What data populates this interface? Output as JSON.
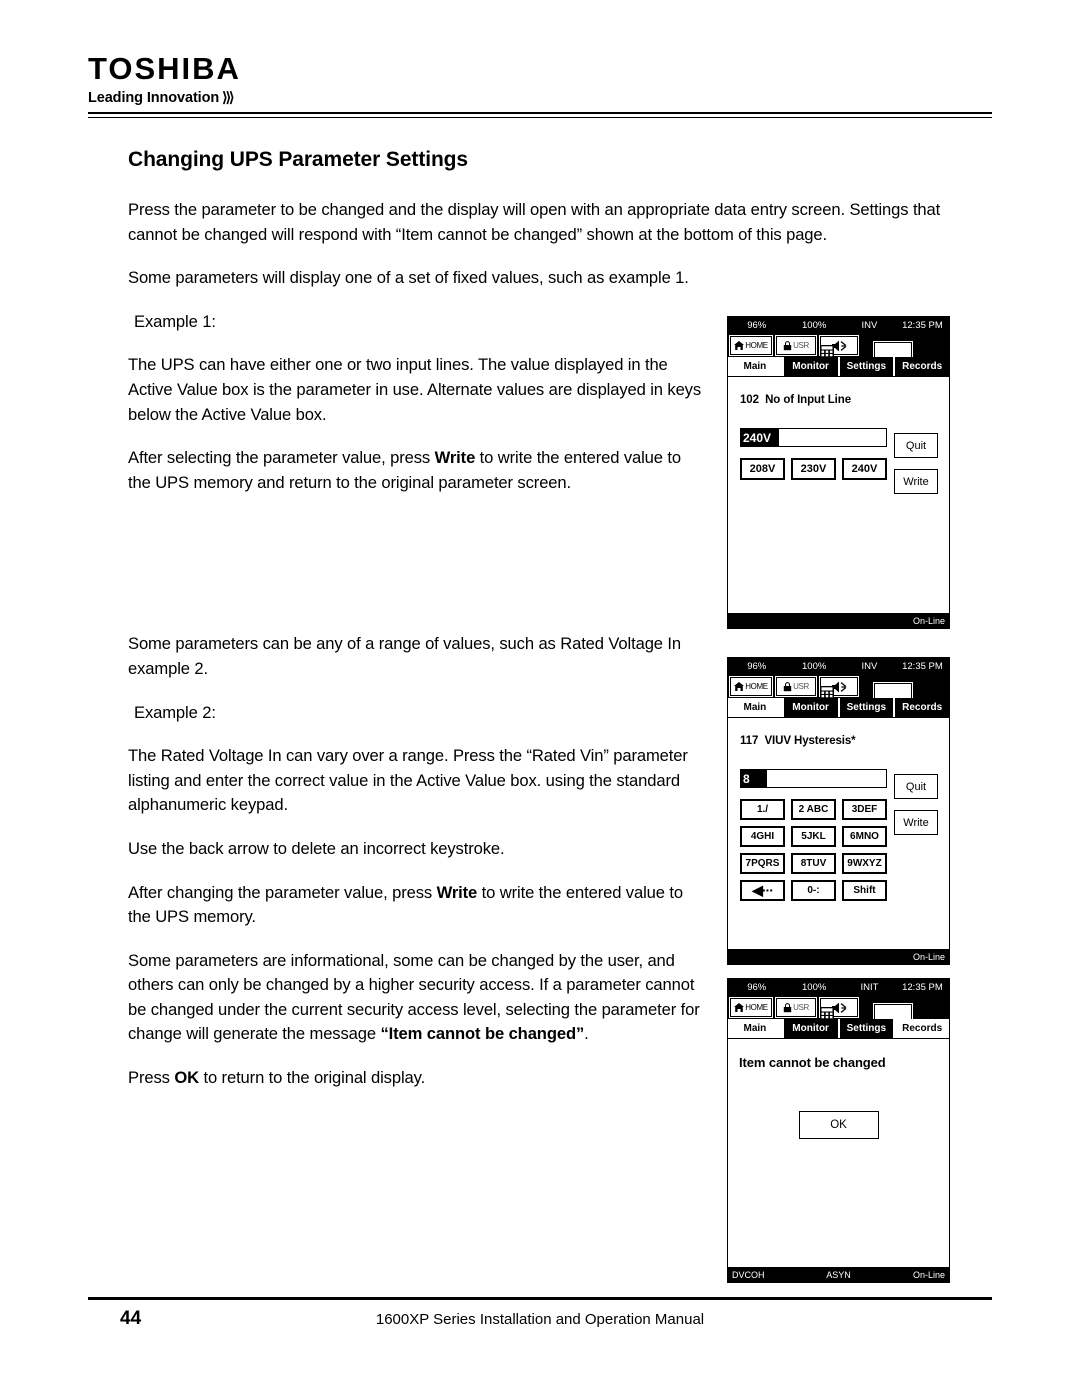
{
  "brand": {
    "name": "TOSHIBA",
    "tagline": "Leading Innovation",
    "chevrons": "≫>"
  },
  "page": {
    "title": "Changing UPS Parameter Settings",
    "paragraphs": {
      "p1": "Press the parameter to be changed and the display will open with an appropriate data entry screen. Settings that cannot be changed will respond with “Item cannot be changed” shown at the bottom of this page.",
      "p2": "Some parameters will display one of a set of fixed values, such as example 1.",
      "example1_label": "Example 1:",
      "p3": "The UPS can have either one or two input lines.  The value displayed in the Active Value box is the parameter in use.  Alternate values are displayed in keys below the Active Value box.",
      "p4_a": "After selecting the parameter value, press ",
      "p4_bold": "Write",
      "p4_b": " to write the entered value to the UPS memory and return to the original parameter screen.",
      "p5": "Some parameters can be any of a range of values, such as Rated Voltage In example 2.",
      "example2_label": "Example 2:",
      "p6": "The Rated Voltage In can vary over a range.  Press the “Rated Vin” parameter listing and enter the correct value in the Active Value box. using the standard alphanumeric keypad.",
      "p7": "Use the back arrow to delete an incorrect keystroke.",
      "p8_a": "After changing the parameter value, press ",
      "p8_bold": "Write",
      "p8_b": " to write the entered value to the UPS memory.",
      "p9_a": "Some parameters are informational, some can be changed by the user, and others can only be changed by a higher security access.  If a parameter cannot be changed under the current security access level, selecting the parameter for change will generate the message ",
      "p9_bold": "“Item cannot be changed”",
      "p9_b": ".",
      "p10_a": "Press ",
      "p10_bold": "OK",
      "p10_b": " to return to the original display."
    }
  },
  "panels": {
    "shared": {
      "icons": {
        "home": "home-icon",
        "home_label": "HOME",
        "lock": "lock-icon",
        "lock_label": "USR",
        "mute": "mute-speaker-icon",
        "keypad": "keypad-grid-icon"
      },
      "tabs": [
        "Main",
        "Monitor",
        "Settings",
        "Records"
      ]
    },
    "panel1": {
      "status_top": {
        "battery": "96%",
        "load": "100%",
        "mode": "INV",
        "time": "12:35 PM"
      },
      "active_tab": "Main",
      "param_number": "102",
      "param_name": "No of Input Line",
      "active_value": "240V",
      "choices": [
        "208V",
        "230V",
        "240V"
      ],
      "side_buttons": [
        "Quit",
        "Write"
      ],
      "status_bottom": {
        "left": "",
        "center": "",
        "right": "On-Line"
      }
    },
    "panel2": {
      "status_top": {
        "battery": "96%",
        "load": "100%",
        "mode": "INV",
        "time": "12:35 PM"
      },
      "active_tab": "Main",
      "param_number": "117",
      "param_name": "VIUV Hysteresis*",
      "active_value": "8",
      "keypad": [
        "1./",
        "2 ABC",
        "3DEF",
        "4GHI",
        "5JKL",
        "6MNO",
        "7PQRS",
        "8TUV",
        "9WXYZ",
        "◀···",
        "0-:",
        "Shift"
      ],
      "side_buttons": [
        "Quit",
        "Write"
      ],
      "status_bottom": {
        "left": "",
        "center": "",
        "right": "On-Line"
      }
    },
    "panel3": {
      "status_top": {
        "battery": "96%",
        "load": "100%",
        "mode": "INIT",
        "time": "12:35 PM"
      },
      "active_tab": "Records",
      "message": "Item cannot be changed",
      "ok_label": "OK",
      "status_bottom": {
        "left": "DVCOH",
        "center": "ASYN",
        "right": "On-Line"
      }
    }
  },
  "footer": {
    "page_number": "44",
    "manual_title": "1600XP Series Installation and Operation Manual"
  }
}
